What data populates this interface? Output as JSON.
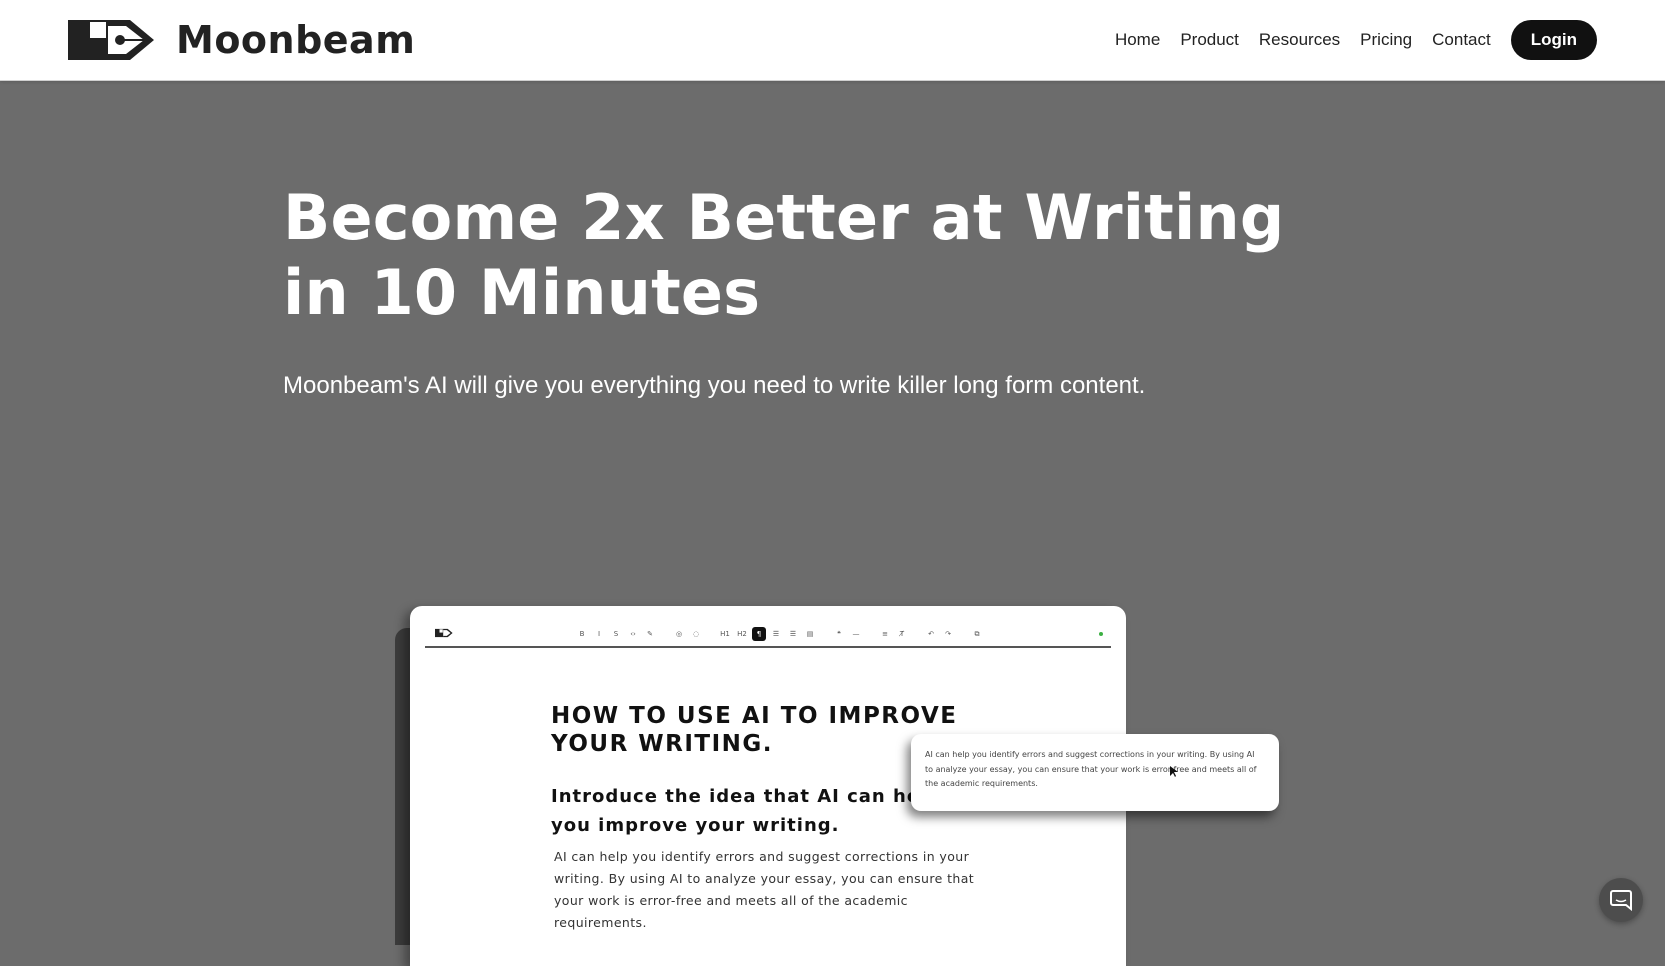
{
  "brand": {
    "name": "Moonbeam",
    "logo_icon": "moonbeam-pen-logo-icon"
  },
  "nav": {
    "links": [
      "Home",
      "Product",
      "Resources",
      "Pricing",
      "Contact"
    ],
    "login_label": "Login"
  },
  "hero": {
    "title": "Become 2x Better at Writing in 10 Minutes",
    "subtitle": "Moonbeam's AI will give you everything you need to write killer long form content."
  },
  "editor_preview": {
    "toolbar_icons": [
      "bold-icon",
      "italic-icon",
      "strikethrough-icon",
      "code-icon",
      "highlight-icon",
      "link-icon",
      "image-icon",
      "heading1-icon",
      "heading2-icon",
      "paragraph-icon",
      "bullet-list-icon",
      "ordered-list-icon",
      "task-list-icon",
      "blockquote-icon",
      "divider-icon",
      "wrap-icon",
      "clear-format-icon",
      "undo-icon",
      "redo-icon",
      "export-icon"
    ],
    "toolbar_labels": {
      "bold": "B",
      "italic": "I",
      "strike": "S",
      "code": "‹›",
      "highlight": "✎",
      "link": "◎",
      "image": "◌",
      "h1": "H1",
      "h2": "H2",
      "paragraph": "¶",
      "bullet": "☰",
      "ordered": "☰",
      "task": "▤",
      "quote": "❝",
      "divider": "—",
      "wrap": "≡",
      "clear": "T̸",
      "undo": "↶",
      "redo": "↷",
      "export": "⧉"
    },
    "document": {
      "heading": "HOW TO USE AI TO IMPROVE YOUR WRITING.",
      "subheading": "Introduce the idea that AI can help you improve your writing.",
      "paragraph": "AI can help you identify errors and suggest corrections in your writing. By using AI to analyze your essay, you can ensure that your work is error-free and meets all of the academic requirements."
    },
    "suggestion_popup": "AI can help you identify errors and suggest corrections in your writing. By using AI to analyze your essay, you can ensure that your work is error-free and meets all of the academic requirements.",
    "status_color": "#3cb043"
  },
  "chat_widget": {
    "icon": "chat-bubble-icon"
  }
}
